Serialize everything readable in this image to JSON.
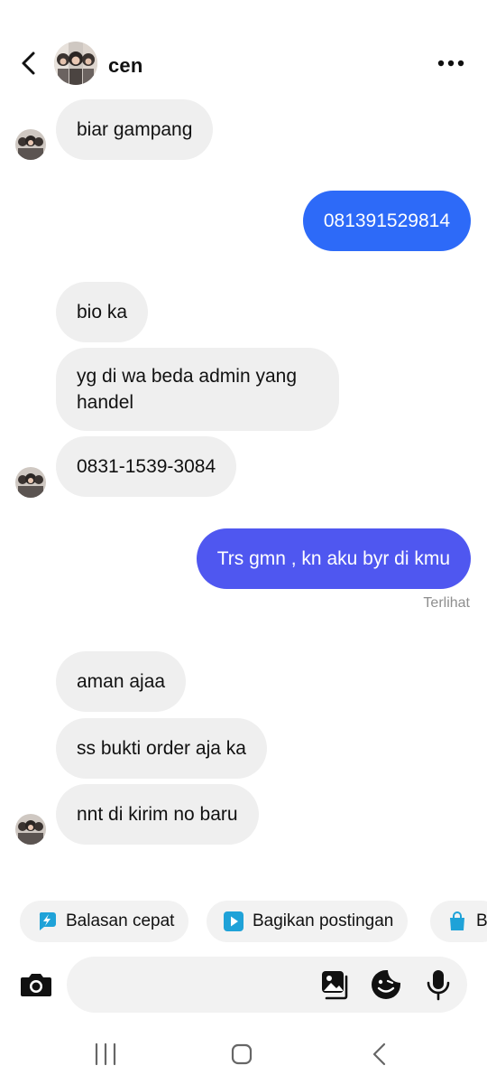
{
  "header": {
    "contact_name": "cen",
    "back_icon": "chevron-left-icon",
    "more_icon": "more-horizontal-icon"
  },
  "messages": [
    {
      "id": "m1",
      "direction": "incoming",
      "text": "biar gampang"
    },
    {
      "id": "m2",
      "direction": "outgoing",
      "text": "081391529814"
    },
    {
      "id": "m3",
      "direction": "incoming",
      "text": "bio ka"
    },
    {
      "id": "m4",
      "direction": "incoming",
      "text": "yg di wa beda admin yang handel"
    },
    {
      "id": "m5",
      "direction": "incoming",
      "text": "0831-1539-3084"
    },
    {
      "id": "m6",
      "direction": "outgoing",
      "text": "Trs gmn , kn aku byr di kmu"
    },
    {
      "id": "m7",
      "direction": "incoming",
      "text": "aman ajaa"
    },
    {
      "id": "m8",
      "direction": "incoming",
      "text": "ss bukti order aja ka"
    },
    {
      "id": "m9",
      "direction": "incoming",
      "text": "nnt di kirim no baru"
    }
  ],
  "seen_status": "Terlihat",
  "quick_replies": [
    {
      "label": "Balasan cepat",
      "icon": "lightning-icon"
    },
    {
      "label": "Bagikan postingan",
      "icon": "play-icon"
    },
    {
      "label": "B",
      "icon": "shopping-bag-icon"
    }
  ],
  "composer": {
    "placeholder": "",
    "camera_icon": "camera-icon",
    "gallery_icon": "gallery-icon",
    "sticker_icon": "sticker-icon",
    "mic_icon": "microphone-icon"
  },
  "navigation_bar": {
    "recents_icon": "recents-icon",
    "home_icon": "home-icon",
    "back_icon": "back-icon"
  },
  "colors": {
    "outgoing_bubble_blue": "#2d6af8",
    "outgoing_bubble_indigo": "#4f57f0",
    "incoming_bubble": "#efefef",
    "quick_reply_icon": "#1fa2d8",
    "seen_text": "#8e8e8e"
  }
}
